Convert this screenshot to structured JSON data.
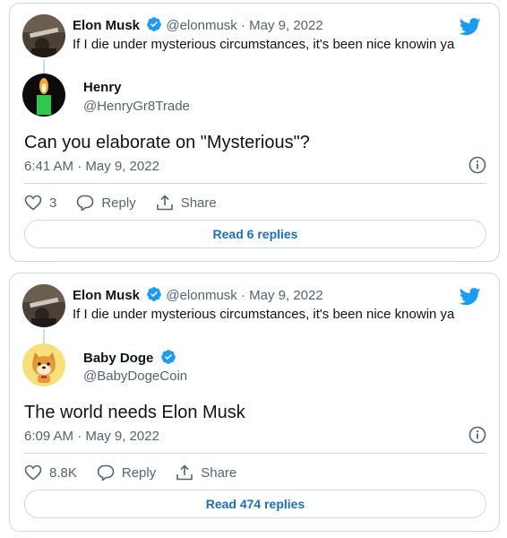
{
  "colors": {
    "border": "#cfd9de",
    "text": "#0f1419",
    "muted": "#536471",
    "blue": "#1d9bf0",
    "link": "#1d6fb8"
  },
  "tweets": [
    {
      "parent": {
        "name": "Elon Musk",
        "handle": "@elonmusk",
        "dot": "·",
        "date": "May 9, 2022",
        "text": "If I die under mysterious circumstances, it's been nice knowin ya"
      },
      "reply": {
        "name": "Henry",
        "handle": "@HenryGr8Trade",
        "verified": false
      },
      "text": "Can you elaborate on \"Mysterious\"?",
      "timestamp": "6:41 AM · May 9, 2022",
      "likes": "3",
      "reply_label": "Reply",
      "share_label": "Share",
      "read_replies": "Read 6 replies"
    },
    {
      "parent": {
        "name": "Elon Musk",
        "handle": "@elonmusk",
        "dot": "·",
        "date": "May 9, 2022",
        "text": "If I die under mysterious circumstances, it's been nice knowin ya"
      },
      "reply": {
        "name": "Baby Doge",
        "handle": "@BabyDogeCoin",
        "verified": true
      },
      "text": "The world needs Elon Musk",
      "timestamp": "6:09 AM · May 9, 2022",
      "likes": "8.8K",
      "reply_label": "Reply",
      "share_label": "Share",
      "read_replies": "Read 474 replies"
    }
  ]
}
